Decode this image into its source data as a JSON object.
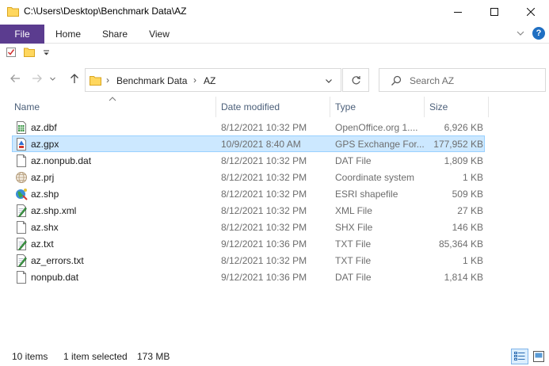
{
  "window": {
    "title": "C:\\Users\\Desktop\\Benchmark Data\\AZ"
  },
  "ribbon": {
    "tabs": [
      "File",
      "Home",
      "Share",
      "View"
    ],
    "help": "?"
  },
  "address": {
    "crumbs": [
      "Benchmark Data",
      "AZ"
    ],
    "separator": "›"
  },
  "search": {
    "placeholder": "Search AZ"
  },
  "columns": {
    "name": "Name",
    "date": "Date modified",
    "type": "Type",
    "size": "Size"
  },
  "files": [
    {
      "name": "az.dbf",
      "date": "8/12/2021 10:32 PM",
      "type": "OpenOffice.org 1....",
      "size": "6,926 KB",
      "icon": "spreadsheet-icon",
      "selected": false
    },
    {
      "name": "az.gpx",
      "date": "10/9/2021 8:40 AM",
      "type": "GPS Exchange For...",
      "size": "177,952 KB",
      "icon": "gpx-file-icon",
      "selected": true
    },
    {
      "name": "az.nonpub.dat",
      "date": "8/12/2021 10:32 PM",
      "type": "DAT File",
      "size": "1,809 KB",
      "icon": "blank-file-icon",
      "selected": false
    },
    {
      "name": "az.prj",
      "date": "8/12/2021 10:32 PM",
      "type": "Coordinate system",
      "size": "1 KB",
      "icon": "globe-file-icon",
      "selected": false
    },
    {
      "name": "az.shp",
      "date": "8/12/2021 10:32 PM",
      "type": "ESRI shapefile",
      "size": "509 KB",
      "icon": "shapefile-globe-icon",
      "selected": false
    },
    {
      "name": "az.shp.xml",
      "date": "8/12/2021 10:32 PM",
      "type": "XML File",
      "size": "27 KB",
      "icon": "notepad-file-icon",
      "selected": false
    },
    {
      "name": "az.shx",
      "date": "8/12/2021 10:32 PM",
      "type": "SHX File",
      "size": "146 KB",
      "icon": "blank-file-icon",
      "selected": false
    },
    {
      "name": "az.txt",
      "date": "9/12/2021 10:36 PM",
      "type": "TXT File",
      "size": "85,364 KB",
      "icon": "notepad-file-icon",
      "selected": false
    },
    {
      "name": "az_errors.txt",
      "date": "8/12/2021 10:32 PM",
      "type": "TXT File",
      "size": "1 KB",
      "icon": "notepad-file-icon",
      "selected": false
    },
    {
      "name": "nonpub.dat",
      "date": "9/12/2021 10:36 PM",
      "type": "DAT File",
      "size": "1,814 KB",
      "icon": "blank-file-icon",
      "selected": false
    }
  ],
  "status": {
    "item_count": "10 items",
    "selection": "1 item selected",
    "selection_size": "173 MB"
  },
  "colors": {
    "file_tab": "#5b3c8f",
    "selection_bg": "#cce8ff",
    "selection_border": "#99d1ff",
    "header_text": "#4c607a",
    "folder_yellow": "#ffd75e"
  }
}
